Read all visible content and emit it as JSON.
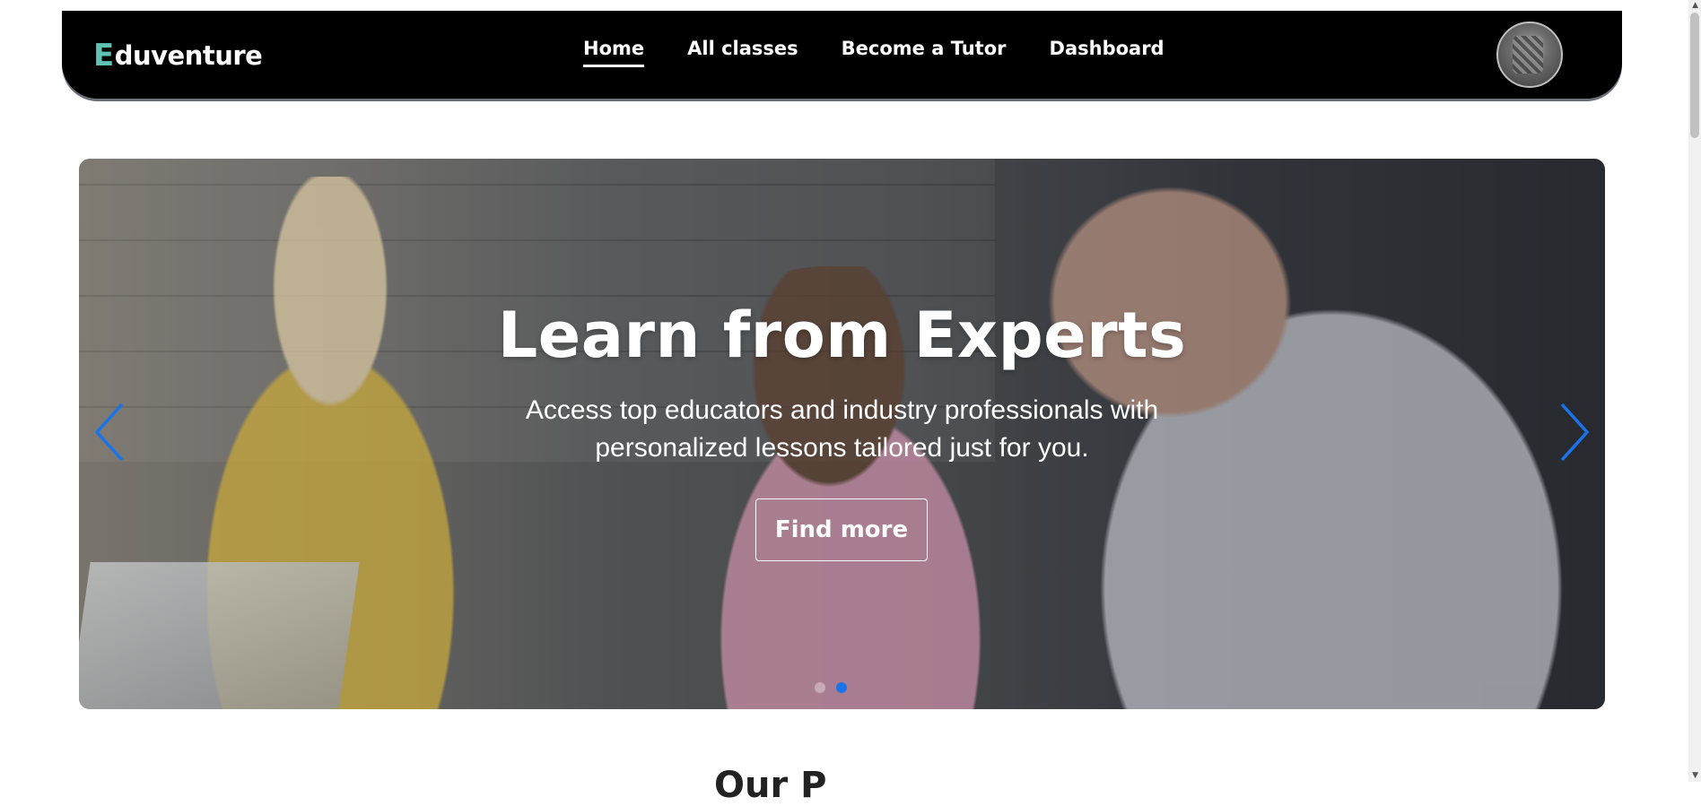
{
  "brand": {
    "logo_initial": "E",
    "logo_rest": "duventure"
  },
  "nav": {
    "links": [
      {
        "label": "Home",
        "active": true
      },
      {
        "label": "All classes"
      },
      {
        "label": "Become a Tutor"
      },
      {
        "label": "Dashboard"
      }
    ]
  },
  "hero": {
    "title": "Learn from Experts",
    "subtitle": "Access top educators and industry professionals with personalized lessons tailored just for you.",
    "button_label": "Find more",
    "slide_count": 2,
    "active_slide": 2
  },
  "section": {
    "peek_title": "Our P"
  },
  "colors": {
    "accent": "#1a73e8",
    "logo_accent": "#5ec3b5",
    "navbar_bg": "#000000"
  }
}
